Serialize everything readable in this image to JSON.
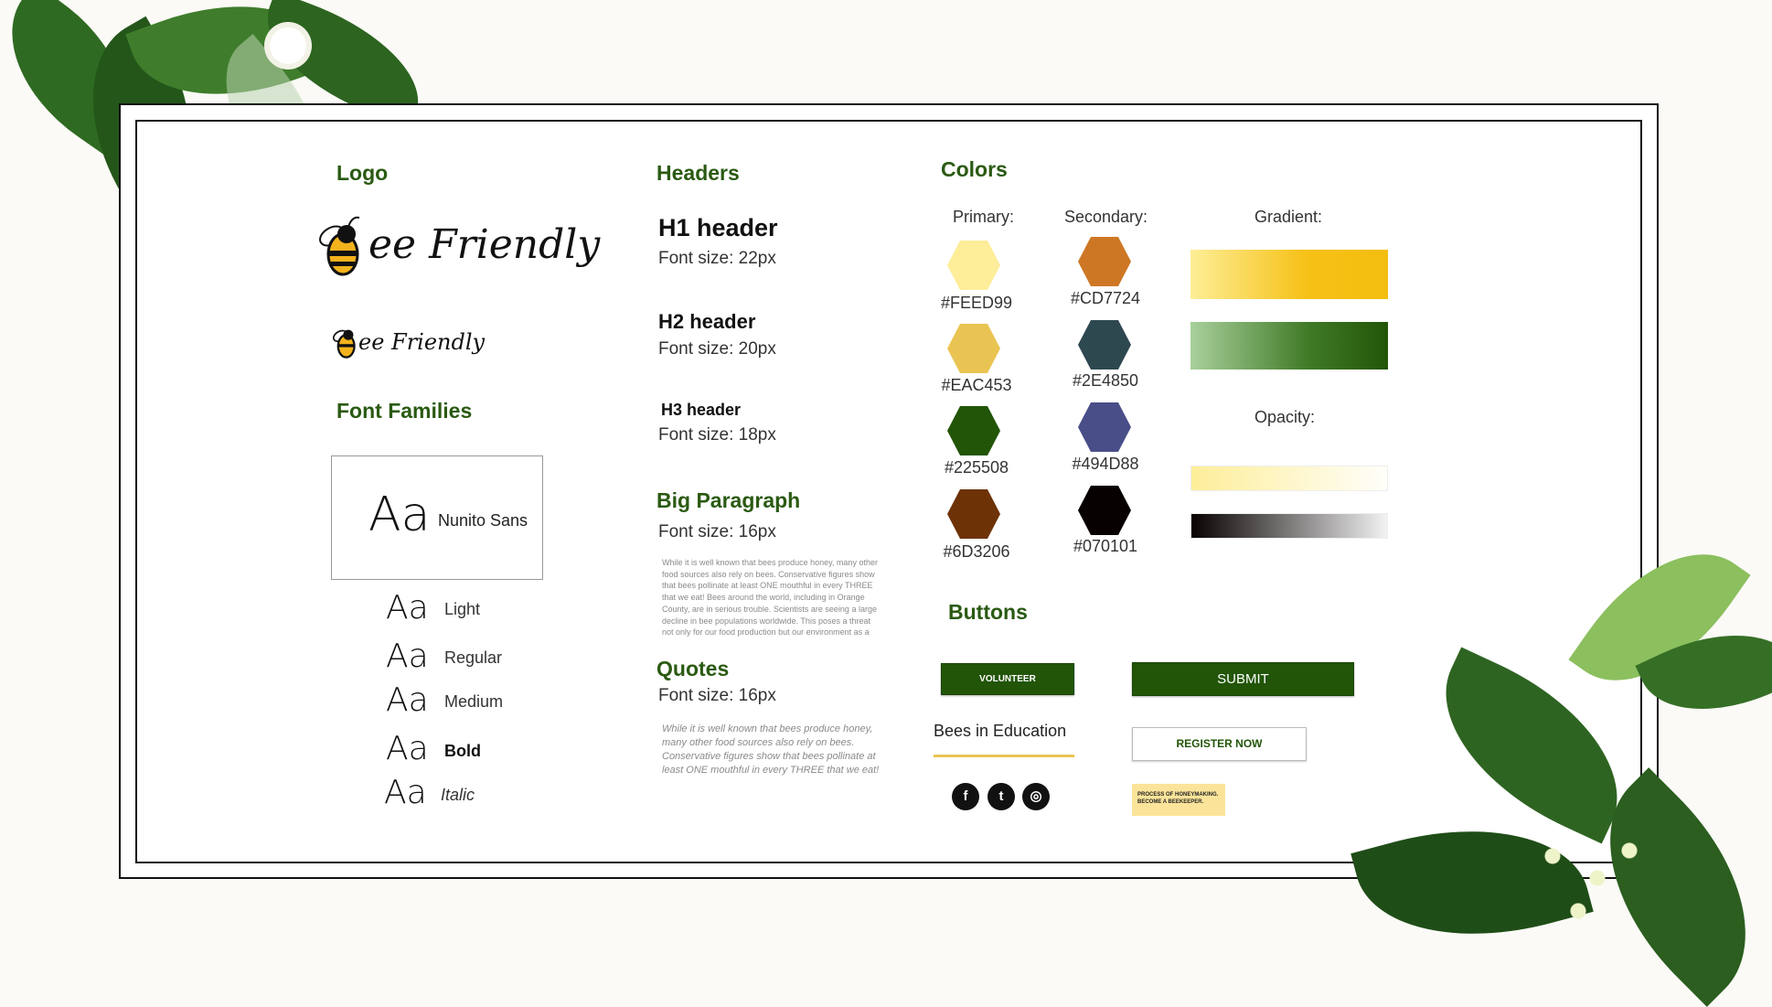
{
  "sections": {
    "logo": "Logo",
    "fonts": "Font Families",
    "headers": "Headers",
    "colors": "Colors",
    "buttons": "Buttons",
    "big_paragraph": "Big Paragraph",
    "quotes": "Quotes"
  },
  "logo": {
    "text": "ee Friendly"
  },
  "font_family": {
    "sample": "Aa",
    "name": "Nunito Sans",
    "weights": [
      "Light",
      "Regular",
      "Medium",
      "Bold",
      "Italic"
    ]
  },
  "headers": {
    "h1": {
      "title": "H1 header",
      "size": "Font size: 22px"
    },
    "h2": {
      "title": "H2 header",
      "size": "Font size: 20px"
    },
    "h3": {
      "title": "H3 header",
      "size": "Font size: 18px"
    },
    "big_paragraph_size": "Font size: 16px",
    "quotes_size": "Font size: 16px"
  },
  "paragraph_lines": [
    "While it is well known that bees produce honey, many other",
    "food sources also rely on bees. Conservative figures show",
    "that bees pollinate at least ONE mouthful in every THREE",
    "that we eat! Bees around the world, including in Orange",
    "County, are in serious trouble.  Scientists are seeing a large",
    "decline in bee populations worldwide. This poses a threat",
    "not only for our food production but our environment as a"
  ],
  "quote_lines": [
    "While it is well known that bees produce honey,",
    "many other food sources also rely on bees.",
    "Conservative figures show that bees pollinate at",
    "least ONE mouthful in every THREE that we eat!"
  ],
  "colors": {
    "primary_label": "Primary:",
    "secondary_label": "Secondary:",
    "gradient_label": "Gradient:",
    "opacity_label": "Opacity:",
    "primary": [
      {
        "hex": "#FEED99",
        "value": "#FEED99"
      },
      {
        "hex": "#EAC453",
        "value": "#EAC453"
      },
      {
        "hex": "#225508",
        "value": "#225508"
      },
      {
        "hex": "#6D3206",
        "value": "#6D3206"
      }
    ],
    "secondary": [
      {
        "hex": "#CD7724",
        "value": "#CD7724"
      },
      {
        "hex": "#2E4850",
        "value": "#2E4850"
      },
      {
        "hex": "#494D88",
        "value": "#494D88"
      },
      {
        "hex": "#070101",
        "value": "#070101"
      }
    ]
  },
  "buttons": {
    "volunteer": "VOLUNTEER",
    "submit": "SUBMIT",
    "bees_in_education": "Bees in Education",
    "register_now": "REGISTER NOW",
    "notice_line1": "PROCESS OF HONEYMAKING.",
    "notice_line2": "BECOME A BEEKEEPER."
  },
  "social": {
    "facebook": "f",
    "twitter": "t",
    "instagram": "◎"
  }
}
